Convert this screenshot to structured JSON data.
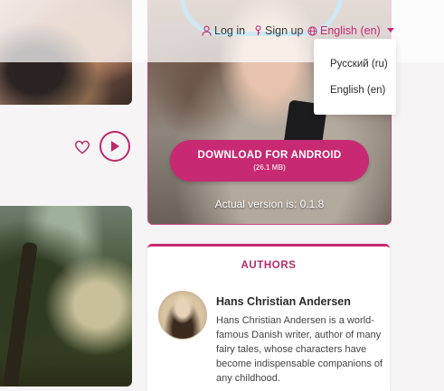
{
  "header": {
    "login_label": "Log in",
    "signup_label": "Sign up",
    "language_label": "English (en)"
  },
  "language_menu": {
    "options": [
      "Русский (ru)",
      "English (en)"
    ]
  },
  "promo": {
    "download_label": "DOWNLOAD FOR ANDROID",
    "download_size": "(26.1 MB)",
    "version_text": "Actual version is: 0.1.8"
  },
  "authors": {
    "title": "AUTHORS",
    "items": [
      {
        "name": "Hans Christian Andersen",
        "bio": "Hans Christian Andersen is a world-famous Danish writer, author of many fairy tales, whose characters have become indispensable companions of any childhood."
      }
    ]
  },
  "colors": {
    "accent": "#c72a72",
    "background": "#f6f4f5"
  },
  "icons": {
    "login": "user-icon",
    "signup": "key-icon",
    "language": "globe-icon",
    "dropdown": "caret-down-icon",
    "like": "heart-icon",
    "play": "play-icon"
  }
}
